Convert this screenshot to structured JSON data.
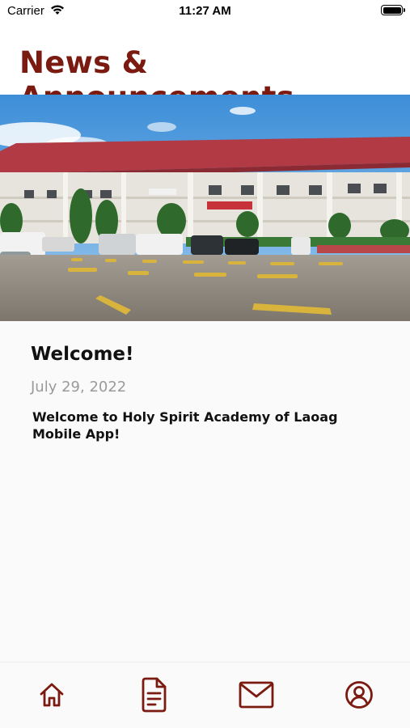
{
  "status_bar": {
    "carrier": "Carrier",
    "time": "11:27 AM",
    "battery_level": 1.0
  },
  "header": {
    "title": "News & Announcements"
  },
  "article": {
    "title": "Welcome!",
    "date": "July 29, 2022",
    "body": "Welcome to Holy Spirit Academy of Laoag Mobile App!"
  },
  "tab_bar": {
    "items": [
      {
        "icon": "home-icon"
      },
      {
        "icon": "document-icon"
      },
      {
        "icon": "mail-icon"
      },
      {
        "icon": "profile-icon"
      }
    ]
  },
  "colors": {
    "accent": "#7a1a10",
    "background": "#fafafa",
    "date_text": "#9a9a9a"
  }
}
